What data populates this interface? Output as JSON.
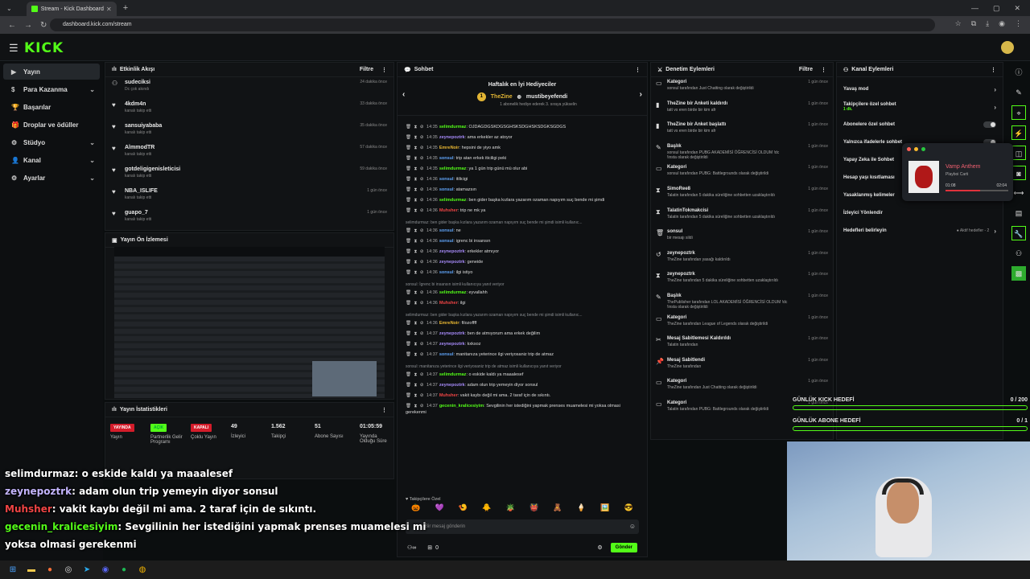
{
  "browser": {
    "tab_title": "Stream - Kick Dashboard",
    "url": "dashboard.kick.com/stream"
  },
  "logo": "KICK",
  "sidebar": [
    {
      "label": "Yayın",
      "icon": "play-icon",
      "active": true,
      "chevron": false
    },
    {
      "label": "Para Kazanma",
      "icon": "money-icon",
      "chevron": true
    },
    {
      "label": "Başarılar",
      "icon": "trophy-icon",
      "chevron": false
    },
    {
      "label": "Droplar ve ödüller",
      "icon": "gift-icon",
      "chevron": false
    },
    {
      "label": "Stüdyo",
      "icon": "gear-icon",
      "chevron": true
    },
    {
      "label": "Kanal",
      "icon": "person-icon",
      "chevron": true
    },
    {
      "label": "Ayarlar",
      "icon": "settings-icon",
      "chevron": true
    }
  ],
  "activity": {
    "title": "Etkinlik Akışı",
    "filter": "Filtre",
    "items": [
      {
        "name": "sudeciksi",
        "sub": "Dc çok akındı",
        "time": "24 dakika önce",
        "icon": "gift",
        "green": true
      },
      {
        "name": "4kdm4n",
        "sub": "kanalı takip etti",
        "time": "33 dakika önce",
        "icon": "heart"
      },
      {
        "name": "sansuiyababa",
        "sub": "kanalı takip etti",
        "time": "35 dakika önce",
        "icon": "heart"
      },
      {
        "name": "AlmmodTR",
        "sub": "kanalı takip etti",
        "time": "57 dakika önce",
        "icon": "heart"
      },
      {
        "name": "gotdeligigenisleticisi",
        "sub": "kanalı takip etti",
        "time": "59 dakika önce",
        "icon": "heart"
      },
      {
        "name": "NBA_ISLIFE",
        "sub": "kanalı takip etti",
        "time": "1 gün önce",
        "icon": "heart"
      },
      {
        "name": "guapo_7",
        "sub": "kanalı takip etti",
        "time": "1 gün önce",
        "icon": "heart"
      }
    ]
  },
  "preview": {
    "title": "Yayın Ön İzlemesi"
  },
  "stats": {
    "title": "Yayın İstatistikleri",
    "items": [
      {
        "badge": "YAYINDA",
        "color": "#d41c2a",
        "label": "Yayın"
      },
      {
        "badge": "AÇIK",
        "color": "#53fc18",
        "label": "Partnerlik Gelir Programı"
      },
      {
        "badge": "KAPALI",
        "color": "#d41c2a",
        "label": "Çoklu Yayın"
      },
      {
        "value": "49",
        "label": "İzleyici"
      },
      {
        "value": "1.562",
        "label": "Takipçi"
      },
      {
        "value": "51",
        "label": "Abone Sayısı"
      },
      {
        "value": "01:05:59",
        "label": "Yayında Olduğu Süre"
      }
    ]
  },
  "chat": {
    "title": "Sohbet",
    "gifters_title": "Haftalık en İyi Hediyeciler",
    "gifter_left": "TheZine",
    "gifter_right": "mustibeyefendi",
    "gifter_sub": "1 abonelik hediye ederek 3. sıraya yükselin",
    "messages": [
      {
        "time": "14:35",
        "user": "selimdurmaz",
        "color": "#53fc18",
        "text": "OJDAGDGSKDGSGHSKSDGHSKSDGKSGDGS"
      },
      {
        "time": "14:35",
        "user": "zeynepoztrk",
        "color": "#a78bfa",
        "text": "ama erkekler az atoyor"
      },
      {
        "time": "14:35",
        "user": "EmreNoir",
        "color": "#e8b632",
        "text": "hepsini de yiyo amk"
      },
      {
        "time": "14:35",
        "user": "sonsul",
        "color": "#60a5fa",
        "text": "trip atan erkek iticiligi peki"
      },
      {
        "time": "14:35",
        "user": "selimdurmaz",
        "color": "#53fc18",
        "text": "ya 1 gün trip günü mü olur abi"
      },
      {
        "time": "14:36",
        "user": "sonsul",
        "color": "#60a5fa",
        "text": "itilicigi"
      },
      {
        "time": "14:36",
        "user": "sonsul",
        "color": "#60a5fa",
        "text": "atamazsın"
      },
      {
        "time": "14:36",
        "user": "selimdurmaz",
        "color": "#53fc18",
        "text": "ben gider başka kızlara yazarım ozaman napıyım suç bende mi şimdi"
      },
      {
        "time": "14:36",
        "user": "Muhsher",
        "color": "#ef4444",
        "text": "trip ne mk ya"
      },
      {
        "reply": "selimdurmaz: ben gider başka kızlara yazarım ozaman napıyım suç bende mi şimdi isimli kullanıc..."
      },
      {
        "time": "14:36",
        "user": "sonsul",
        "color": "#60a5fa",
        "text": "ne"
      },
      {
        "time": "14:36",
        "user": "sonsul",
        "color": "#60a5fa",
        "text": "igrenc bi insansın"
      },
      {
        "time": "14:36",
        "user": "zeynepoztrk",
        "color": "#a78bfa",
        "text": "erkekler atmıyor"
      },
      {
        "time": "14:36",
        "user": "zeynepoztrk",
        "color": "#a78bfa",
        "text": "geneide"
      },
      {
        "time": "14:36",
        "user": "sonsul",
        "color": "#60a5fa",
        "text": "ilgi istiyo"
      },
      {
        "reply": "sonsul: İgrenc bi insansın isimli kullanıcıya yanıt veriyor"
      },
      {
        "time": "14:36",
        "user": "selimdurmaz",
        "color": "#53fc18",
        "text": "eyvallahh"
      },
      {
        "time": "14:36",
        "user": "Muhsher",
        "color": "#ef4444",
        "text": "ilgi"
      },
      {
        "reply": "selimdurmaz: ben gider başka kızlara yazarım ozaman napıyım suç bende mi şimdi isimli kullanıc..."
      },
      {
        "time": "14:36",
        "user": "EmreNoir",
        "color": "#e8b632",
        "text": "filozoffff"
      },
      {
        "time": "14:37",
        "user": "zeynepoztrk",
        "color": "#a78bfa",
        "text": "ben de atmıyorum ama erkek değilim"
      },
      {
        "time": "14:37",
        "user": "zeynepoztrk",
        "color": "#a78bfa",
        "text": "kxksoz"
      },
      {
        "time": "14:37",
        "user": "sonsul",
        "color": "#60a5fa",
        "text": "manitanıza yeterince ilgi veriyosaniz trip de atmaz"
      },
      {
        "reply": "sonsul: manitanıza yeterince ilgi veriyosaniz trip de atmaz isimli kullanıcıya yanıt veriyor"
      },
      {
        "time": "14:37",
        "user": "selimdurmaz",
        "color": "#53fc18",
        "text": "o eskide kaldı ya maaalesef"
      },
      {
        "time": "14:37",
        "user": "zeynepoztrk",
        "color": "#a78bfa",
        "text": "adam olun trip yemeyin diyor sonsul"
      },
      {
        "time": "14:37",
        "user": "Muhsher",
        "color": "#ef4444",
        "text": "vakit kaybı değil mi ama. 2 taraf için de sıkıntı."
      },
      {
        "time": "14:37",
        "user": "gecenin_kralicesiyim",
        "color": "#53fc18",
        "text": "Sevgilinin her istediğini yapmak prenses muamelesi mi yoksa olmasi gerekenmi"
      }
    ],
    "emotes": [
      "🎃",
      "💜",
      "🍤",
      "🐥",
      "🪴",
      "👹",
      "🧸",
      "🍦",
      "🖼️",
      "😎"
    ],
    "followers_only": "Takipçilere Özel",
    "input_placeholder": "Bir mesaj gönderin",
    "viewers_icon_count": "0",
    "send_label": "Gönder"
  },
  "mod": {
    "title": "Denetim Eylemleri",
    "filter": "Filtre",
    "items": [
      {
        "icon": "▭",
        "name": "Kategori",
        "sub": "sonsul tarafından Just Chatting olarak değiştirildi",
        "time": "1 gün önce"
      },
      {
        "icon": "▮",
        "name": "TheZine bir Anketi kaldırdı",
        "sub": "tatt vs eren birde bir kim afr",
        "time": "1 gün önce"
      },
      {
        "icon": "▮",
        "name": "TheZine bir Anket başlattı",
        "sub": "tatt vs eren birde bir kim afr",
        "time": "1 gün önce"
      },
      {
        "icon": "✎",
        "name": "Başlık",
        "sub": "sonsul tarafından PUBG AKADEMİSİ ÖĞRENCİSİ OLDUM !dc !insta olarak değiştirildi",
        "time": "1 gün önce"
      },
      {
        "icon": "▭",
        "name": "Kategori",
        "sub": "sonsul tarafından PUBG: Battlegrounds olarak değiştirildi",
        "time": "1 gün önce"
      },
      {
        "icon": "⧗",
        "name": "SimoRee8",
        "sub": "Talatin tarafından 5 dakika süreliğine sohbetten uzaklaştırıldı",
        "time": "1 gün önce"
      },
      {
        "icon": "⧗",
        "name": "TalatinTokmakcisi",
        "sub": "Talatin tarafından 5 dakika süreliğine sohbetten uzaklaştırıldı",
        "time": "1 gün önce"
      },
      {
        "icon": "🗑",
        "name": "sonsul",
        "sub": "bir mesajı sildi",
        "time": "1 gün önce"
      },
      {
        "icon": "↺",
        "name": "zeynepoztrk",
        "sub": "TheZine tarafından yasağı kaldırıldı",
        "time": "1 gün önce"
      },
      {
        "icon": "⧗",
        "name": "zeynepoztrk",
        "sub": "TheZine tarafından 5 dakika süreliğine sohbetten uzaklaştırıldı",
        "time": "1 gün önce"
      },
      {
        "icon": "✎",
        "name": "Başlık",
        "sub": "ThePublisher tarafından LOL AKADEMİSİ ÖĞRENCİSİ OLDUM !dc !insta olarak değiştirildi",
        "time": "1 gün önce"
      },
      {
        "icon": "▭",
        "name": "Kategori",
        "sub": "TheZine tarafından League of Legends olarak değiştirildi",
        "time": "1 gün önce"
      },
      {
        "icon": "✂",
        "name": "Mesaj Sabitlemesi Kaldırıldı",
        "sub": "Talatin tarafından",
        "time": "1 gün önce"
      },
      {
        "icon": "📌",
        "name": "Mesaj Sabitlendi",
        "sub": "TheZine tarafından",
        "time": "1 gün önce"
      },
      {
        "icon": "▭",
        "name": "Kategori",
        "sub": "TheZine tarafından Just Chatting olarak değiştirildi",
        "time": "1 gün önce"
      },
      {
        "icon": "▭",
        "name": "Kategori",
        "sub": "Talatin tarafından PUBG: Battlegrounds olarak değiştirildi",
        "time": "1 gün önce"
      }
    ]
  },
  "channel": {
    "title": "Kanal Eylemleri",
    "items": [
      {
        "label": "Yavaş mod",
        "right": "›"
      },
      {
        "label": "Takipçilere özel sohbet",
        "sub": "1 dk.",
        "right": "›"
      },
      {
        "label": "Abonelere özel sohbet",
        "toggle": true
      },
      {
        "label": "Yalnızca ifadelerle sohbet",
        "toggle": true
      },
      {
        "label": "Yapay Zeka ile Sohbet",
        "toggle": false
      },
      {
        "label": "Hesap yaşı kısıtlaması",
        "toggle": false
      },
      {
        "label": "Yasaklanmış kelimeler",
        "toggle": false
      },
      {
        "label": "İzleyici Yönlendir",
        "toggle": false
      },
      {
        "label": "Hedefleri belirleyin",
        "extra": "● Aktif hedefler - 2",
        "right": "›"
      }
    ]
  },
  "player": {
    "title": "Vamp Anthem",
    "artist": "Playboi Carti",
    "elapsed": "01:08",
    "total": "02:04",
    "progress": 0.55
  },
  "goals": [
    {
      "title": "GÜNLÜK KICK HEDEFİ",
      "value": "0 / 200"
    },
    {
      "title": "GÜNLÜK ABONE HEDEFİ",
      "value": "0 / 1"
    }
  ],
  "overlay_chat": [
    {
      "user": "selimdurmaz",
      "color": "#ffffff",
      "text": ": o eskide kaldı ya maaalesef"
    },
    {
      "user": "zeynepoztrk",
      "color": "#c4b5fd",
      "text": ": adam olun trip yemeyin diyor sonsul"
    },
    {
      "user": "Muhsher",
      "color": "#ef4444",
      "text": ": vakit kaybı değil mi ama. 2 taraf için de sıkıntı."
    },
    {
      "user": "gecenin_kralicesiyim",
      "color": "#53fc18",
      "text": ": Sevgilinin her istediğini yapmak prenses muamelesi mi"
    },
    {
      "user": "",
      "color": "#ffffff",
      "text": "yoksa olmasi gerekenmi"
    }
  ]
}
